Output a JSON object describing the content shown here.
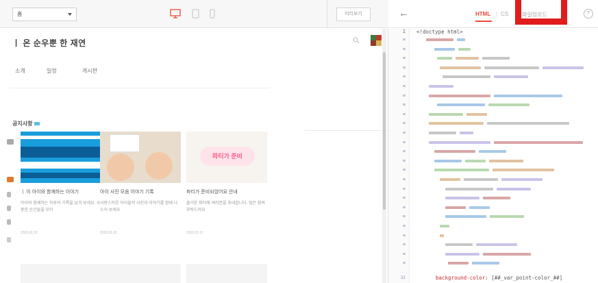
{
  "left_toolbar": {
    "page_select_value": "홈",
    "preview_label": "미리보기"
  },
  "preview": {
    "site_title": "ㅣ 온 순우뿐 한 재연",
    "nav_items": [
      "소개",
      "일정",
      "게시판"
    ],
    "section_heading": "공지사항",
    "cards": [
      {
        "title": "ㅣ 이 아이와 함께하는 이야기",
        "desc": "아이와 함께하는 하루의 기록을 남겨 보세요. 소중한 순간들을 모아",
        "date": "2020.01.01"
      },
      {
        "title": "아이 사진 모음 이야기 기록",
        "desc": "사랑스러운 아이들의 사진과 이야기를 함께 나누어 보세요",
        "date": "2020.01.01"
      },
      {
        "title": "파티가 준비되었어요 안내",
        "desc": "즐거운 파티에 여러분을 초대합니다. 많은 참여 부탁드려요",
        "date": "2020.01.01"
      }
    ],
    "thumb3_text": "파티가 준비"
  },
  "editor": {
    "back_icon": "arrow-left-icon",
    "tabs": [
      "HTML",
      "CS",
      "파일업로드"
    ],
    "active_tab": "HTML",
    "help_label": "?",
    "first_line_no": "1",
    "first_line_code": "<!doctype html>",
    "last_line_no": "32",
    "last_line_prop": "background-color:",
    "last_line_val": " [##_var_point-color_##]"
  },
  "colors": {
    "accent": "#e84a3a",
    "highlight_box": "#e01c1c"
  }
}
